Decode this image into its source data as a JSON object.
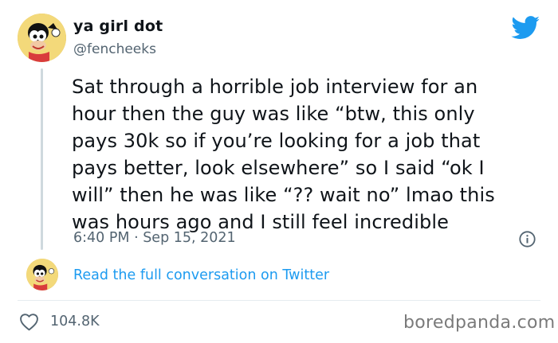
{
  "tweet": {
    "display_name": "ya girl dot",
    "handle": "@fencheeks",
    "text": "Sat through a horrible job interview for an\nhour then the guy was like “btw, this only\npays 30k so if you’re looking for a job that\npays better, look elsewhere” so I said “ok I\nwill” then he was like “?? wait no” lmao this\nwas hours ago and I still feel incredible",
    "timestamp": "6:40 PM · Sep 15, 2021",
    "likes": "104.8K",
    "conversation_link": "Read the full conversation on Twitter"
  },
  "icons": {
    "brand": "twitter-bird-icon",
    "info": "info-icon",
    "like": "heart-icon"
  },
  "colors": {
    "twitter_blue": "#1d9bf0",
    "secondary_text": "#536471",
    "primary_text": "#0f1419"
  },
  "watermark": "boredpanda.com"
}
